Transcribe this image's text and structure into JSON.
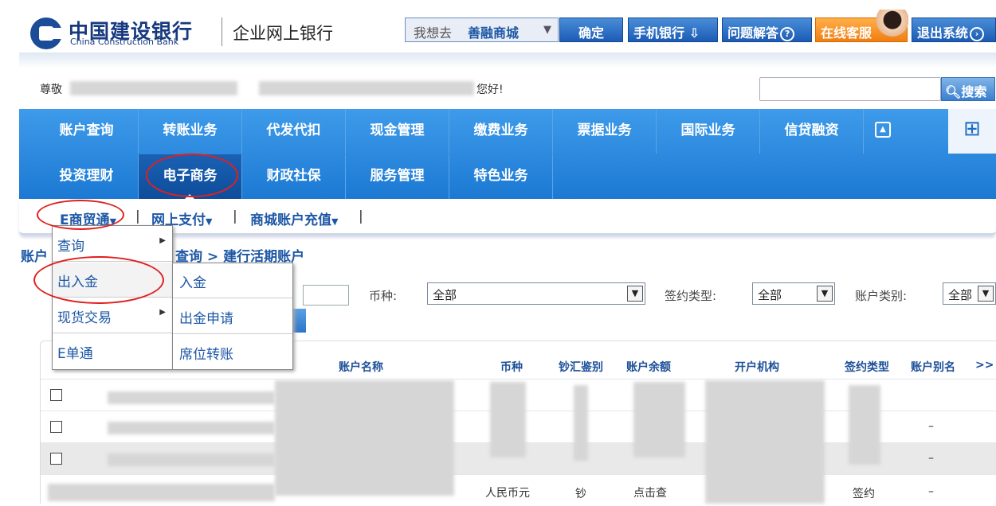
{
  "header": {
    "bank_name_cn": "中国建设银行",
    "bank_name_en": "China Construction Bank",
    "product": "企业网上银行",
    "search": {
      "prefix": "我想去",
      "value": "善融商城"
    },
    "ok_label": "确定",
    "mobile_label": "手机银行",
    "faq_label": "问题解答",
    "cs_label": "在线客服",
    "exit_label": "退出系统"
  },
  "greeting": {
    "prefix": "尊敬",
    "suffix": "您好!"
  },
  "search": {
    "button_label": "搜索"
  },
  "nav": {
    "row1": [
      "账户查询",
      "转账业务",
      "代发代扣",
      "现金管理",
      "缴费业务",
      "票据业务",
      "国际业务",
      "信贷融资"
    ],
    "row2": [
      "投资理财",
      "电子商务",
      "财政社保",
      "服务管理",
      "特色业务"
    ]
  },
  "subnav": [
    "E商贸通",
    "网上支付",
    "商城账户充值"
  ],
  "breadcrumb": {
    "left": "账户",
    "right": "查询 > 建行活期账户"
  },
  "filters": {
    "currency_label": "币种:",
    "currency_value": "全部",
    "sign_label": "签约类型:",
    "sign_value": "全部",
    "acct_label": "账户类别:",
    "acct_value": "全部"
  },
  "table": {
    "headers": [
      "账户名称",
      "币种",
      "钞汇鉴别",
      "账户余额",
      "开户机构",
      "签约类型",
      "账户别名"
    ],
    "more": ">>",
    "last_row": {
      "currency": "人民币元",
      "cash": "钞",
      "balance": "点击查",
      "sign": "签约"
    },
    "dash": "–"
  },
  "menu_level1": [
    "查询",
    "出入金",
    "现货交易",
    "E单通"
  ],
  "menu_level2": [
    "入金",
    "出金申请",
    "席位转账"
  ]
}
